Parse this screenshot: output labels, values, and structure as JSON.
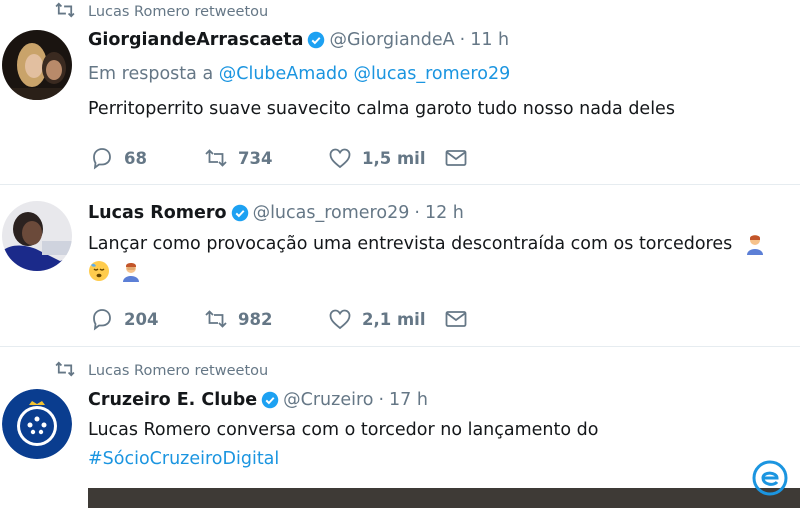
{
  "tweets": [
    {
      "retweet_label": "Lucas Romero retweetou",
      "name": "GiorgiandeArrascaeta",
      "handle": "@GiorgiandeA",
      "time": "11 h",
      "reply_prefix": "Em resposta a",
      "reply_to": [
        "@ClubeAmado",
        "@lucas_romero29"
      ],
      "text": "Perritoperrito suave suavecito calma garoto tudo nosso nada deles",
      "replies": "68",
      "retweets": "734",
      "likes": "1,5 mil"
    },
    {
      "name": "Lucas Romero",
      "handle": "@lucas_romero29",
      "time": "12 h",
      "text": "Lançar como provocação uma entrevista descontraída com os torcedores",
      "replies": "204",
      "retweets": "982",
      "likes": "2,1 mil"
    },
    {
      "retweet_label": "Lucas Romero retweetou",
      "name": "Cruzeiro E. Clube",
      "handle": "@Cruzeiro",
      "time": "17 h",
      "text": "Lucas Romero conversa com o torcedor no lançamento do",
      "hashtag": "#SócioCruzeiroDigital"
    }
  ],
  "colors": {
    "link": "#1b95e0",
    "muted": "#657786",
    "verified": "#1da1f2"
  }
}
